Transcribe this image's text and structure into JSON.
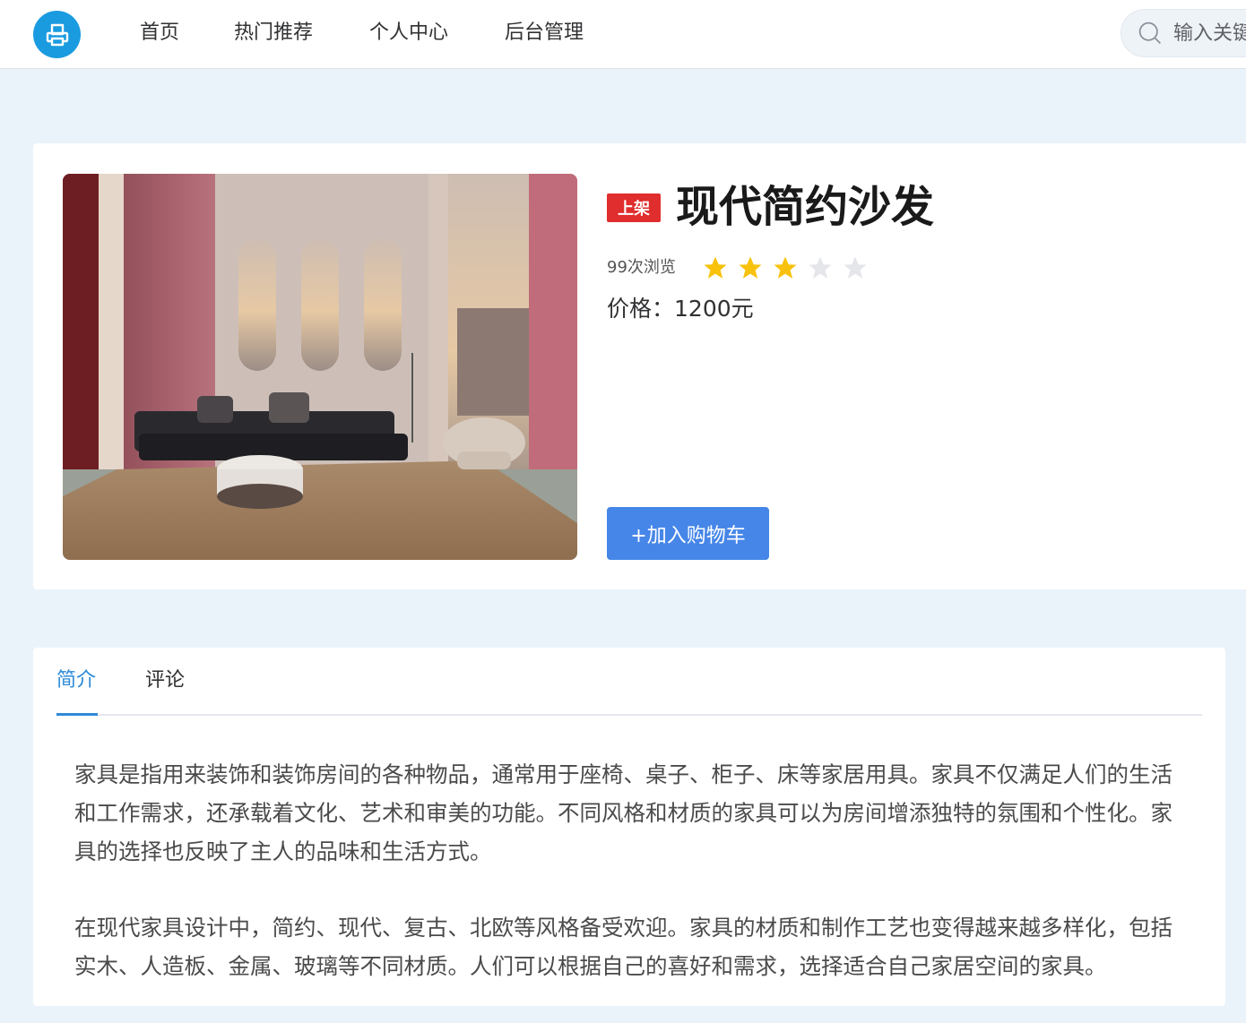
{
  "header": {
    "nav": [
      {
        "label": "首页"
      },
      {
        "label": "热门推荐"
      },
      {
        "label": "个人中心"
      },
      {
        "label": "后台管理"
      }
    ],
    "search": {
      "placeholder": "输入关键字"
    }
  },
  "product": {
    "status_badge": "上架",
    "title": "现代简约沙发",
    "views": "99次浏览",
    "rating": {
      "value": 3,
      "max": 5
    },
    "price_label": "价格：",
    "price_value": "1200元",
    "add_to_cart": "+加入购物车"
  },
  "tabs": [
    {
      "label": "简介",
      "active": true
    },
    {
      "label": "评论",
      "active": false
    }
  ],
  "description": [
    "家具是指用来装饰和装饰房间的各种物品，通常用于座椅、桌子、柜子、床等家居用具。家具不仅满足人们的生活和工作需求，还承载着文化、艺术和审美的功能。不同风格和材质的家具可以为房间增添独特的氛围和个性化。家具的选择也反映了主人的品味和生活方式。",
    "在现代家具设计中，简约、现代、复古、北欧等风格备受欢迎。家具的材质和制作工艺也变得越来越多样化，包括实木、人造板、金属、玻璃等不同材质。人们可以根据自己的喜好和需求，选择适合自己家居空间的家具。"
  ],
  "colors": {
    "accent_blue": "#4686e8",
    "logo_blue": "#1a9be0",
    "badge_red": "#e02d2d",
    "star_on": "#f8c20c",
    "star_off": "#e4e6ea",
    "tab_active": "#2e8ad8",
    "page_bg": "#eaf3fa"
  },
  "icons": [
    "printer-icon",
    "search-icon",
    "star-icon"
  ]
}
